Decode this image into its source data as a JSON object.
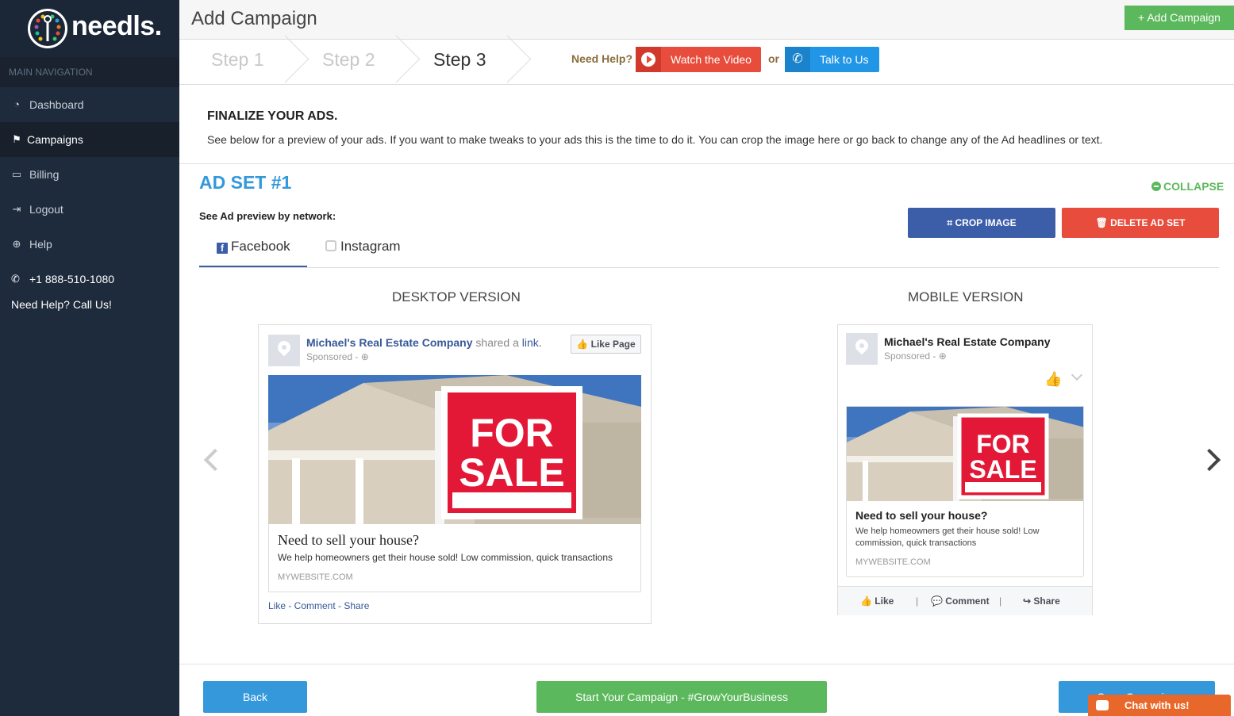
{
  "brand": {
    "name": "needls."
  },
  "sidebar": {
    "section_label": "MAIN NAVIGATION",
    "items": [
      {
        "label": "Dashboard",
        "icon": "dashboard-icon"
      },
      {
        "label": "Campaigns",
        "icon": "flag-icon"
      },
      {
        "label": "Billing",
        "icon": "credit-card-icon"
      },
      {
        "label": "Logout",
        "icon": "sign-out-icon"
      },
      {
        "label": "Help",
        "icon": "life-ring-icon"
      }
    ],
    "phone": "+1 888-510-1080",
    "call_us": "Need Help? Call Us!"
  },
  "header": {
    "title": "Add Campaign",
    "add_button": "+ Add Campaign"
  },
  "steps": {
    "items": [
      "Step 1",
      "Step 2",
      "Step 3"
    ],
    "active": 2,
    "need_help": "Need Help?",
    "watch_video": "Watch the Video",
    "or": "or",
    "talk_to_us": "Talk to Us"
  },
  "finalize": {
    "title": "FINALIZE YOUR ADS.",
    "description": "See below for a preview of your ads. If you want to make tweaks to your ads this is the time to do it. You can crop the image here or go back to change any of the Ad headlines or text."
  },
  "adset": {
    "title": "AD SET #1",
    "collapse": "COLLAPSE",
    "preview_label": "See Ad preview by network:",
    "crop_button": "CROP IMAGE",
    "delete_button": "DELETE AD SET",
    "tabs": [
      "Facebook",
      "Instagram"
    ],
    "active_tab": 0,
    "desktop_heading": "DESKTOP VERSION",
    "mobile_heading": "MOBILE VERSION"
  },
  "ad": {
    "page_name": "Michael's Real Estate Company",
    "shared": "shared a",
    "link": "link.",
    "sponsored": "Sponsored - ⊕",
    "like_page": "Like Page",
    "sign_line1": "FOR",
    "sign_line2": "SALE",
    "headline": "Need to sell your house?",
    "description": "We help homeowners get their house sold! Low commission, quick transactions",
    "url": "MYWEBSITE.COM",
    "desktop_actions": "Like - Comment - Share",
    "mobile_actions": {
      "like": "Like",
      "comment": "Comment",
      "share": "Share",
      "sep": "|"
    }
  },
  "footer": {
    "back": "Back",
    "start": "Start Your Campaign - #GrowYourBusiness",
    "save": "Save Campaign",
    "chat": "Chat with us!"
  },
  "colors": {
    "sidebar": "#1e2b3c",
    "accent_blue": "#3498db",
    "green": "#5cb85c",
    "red": "#e74c3c",
    "facebook": "#3c5da8",
    "chat_orange": "#e8672a"
  }
}
